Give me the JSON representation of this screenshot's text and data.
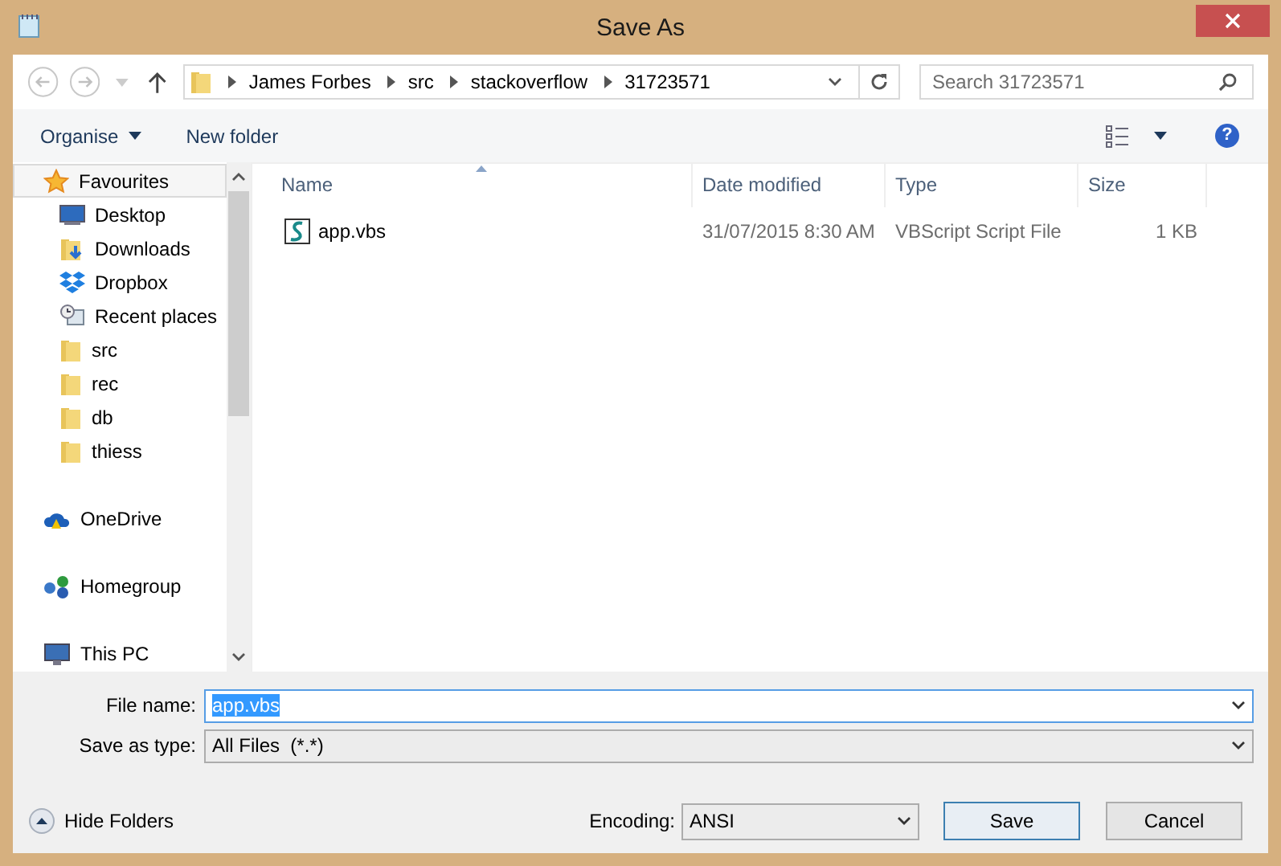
{
  "window": {
    "title": "Save As"
  },
  "breadcrumb": [
    "James Forbes",
    "src",
    "stackoverflow",
    "31723571"
  ],
  "search": {
    "placeholder": "Search 31723571"
  },
  "toolbar": {
    "organise": "Organise",
    "new_folder": "New folder",
    "help": "?"
  },
  "sidebar": {
    "items": [
      {
        "label": "Favourites",
        "kind": "star",
        "selected": true,
        "children": [
          {
            "label": "Desktop",
            "kind": "desktop",
            "selected": false
          },
          {
            "label": "Downloads",
            "kind": "downloads",
            "selected": false
          },
          {
            "label": "Dropbox",
            "kind": "dropbox",
            "selected": false
          },
          {
            "label": "Recent places",
            "kind": "recent",
            "selected": false
          },
          {
            "label": "src",
            "kind": "folder",
            "selected": false
          },
          {
            "label": "rec",
            "kind": "folder",
            "selected": false
          },
          {
            "label": "db",
            "kind": "folder",
            "selected": false
          },
          {
            "label": "thiess",
            "kind": "folder",
            "selected": false
          }
        ]
      },
      {
        "label": "OneDrive",
        "kind": "cloud",
        "selected": false
      },
      {
        "label": "Homegroup",
        "kind": "homegroup",
        "selected": false
      },
      {
        "label": "This PC",
        "kind": "pc",
        "selected": false
      }
    ]
  },
  "table": {
    "columns": [
      "Name",
      "Date modified",
      "Type",
      "Size"
    ],
    "rows": [
      {
        "name": "app.vbs",
        "date": "31/07/2015 8:30 AM",
        "type": "VBScript Script File",
        "size": "1 KB",
        "selected": false
      }
    ]
  },
  "form": {
    "file_name_label": "File name:",
    "file_name": "app.vbs",
    "type_label": "Save as type:",
    "type": "All Files  (*.*)"
  },
  "footer": {
    "hide_folders": "Hide Folders",
    "encoding_label": "Encoding:",
    "encoding": "ANSI",
    "save": "Save",
    "cancel": "Cancel"
  }
}
